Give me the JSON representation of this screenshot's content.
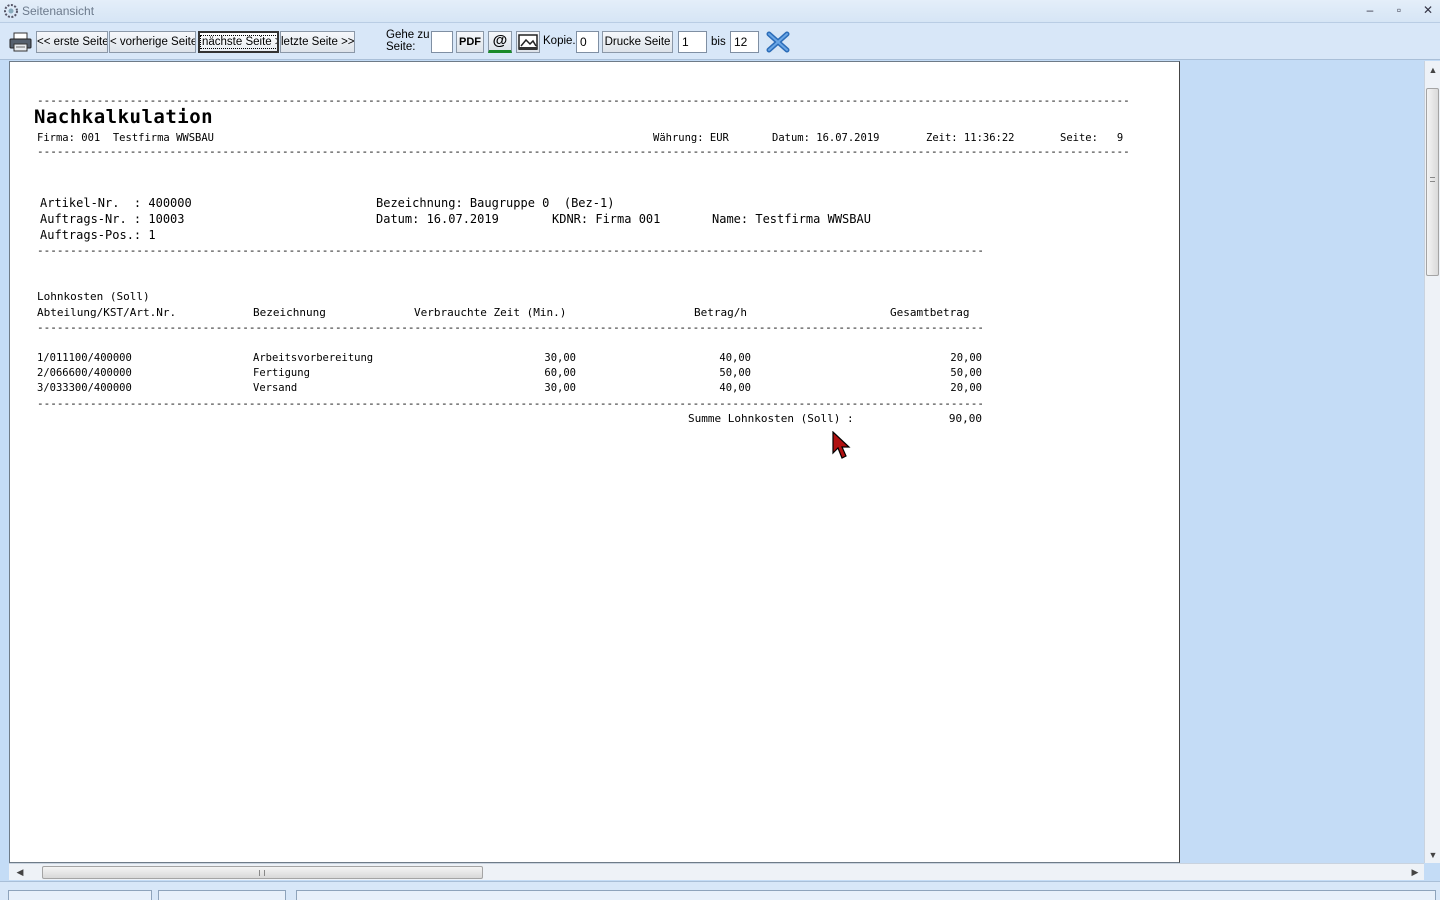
{
  "window": {
    "title": "Seitenansicht",
    "controls": {
      "minimize": "–",
      "restore": "▫",
      "close": "✕"
    }
  },
  "toolbar": {
    "first_page": "<< erste Seite",
    "prev_page": "< vorherige Seite",
    "next_page": "nächste Seite >",
    "last_page": "letzte Seite >>",
    "goto_label_1": "Gehe zu",
    "goto_label_2": "Seite:",
    "goto_value": "",
    "pdf_label": "PDF",
    "email_symbol": "@",
    "copies_label": "Kopie.:",
    "copies_value": "0",
    "print_pages_label": "Drucke Seite",
    "from_value": "1",
    "to_label": "bis",
    "to_value": "12",
    "icons": [
      "printer-icon",
      "email-icon",
      "image-export-icon",
      "close-preview-icon"
    ]
  },
  "report": {
    "title": "Nachkalkulation",
    "firma": "Firma: 001  Testfirma WWSBAU",
    "waehrung": "Währung: EUR",
    "datum": "Datum: 16.07.2019",
    "zeit": "Zeit: 11:36:22",
    "seite": "Seite:   9",
    "artikel_nr": "Artikel-Nr.  : 400000",
    "auftrags_nr": "Auftrags-Nr. : 10003",
    "auftrags_pos": "Auftrags-Pos.: 1",
    "bezeichnung": "Bezeichnung: Baugruppe 0  (Bez-1)",
    "datum2": "Datum: 16.07.2019",
    "kdnr": "KDNR: Firma 001",
    "name": "Name: Testfirma WWSBAU",
    "section_title": "Lohnkosten (Soll)",
    "columns": [
      "Abteilung/KST/Art.Nr.",
      "Bezeichnung",
      "Verbrauchte Zeit (Min.)",
      "Betrag/h",
      "Gesamtbetrag"
    ],
    "rows": [
      [
        "1/011100/400000",
        "Arbeitsvorbereitung",
        "30,00",
        "40,00",
        "20,00"
      ],
      [
        "2/066600/400000",
        "Fertigung",
        "60,00",
        "50,00",
        "50,00"
      ],
      [
        "3/033300/400000",
        "Versand",
        "30,00",
        "40,00",
        "20,00"
      ]
    ],
    "sum_label": "Summe Lohnkosten (Soll) :",
    "sum_value": "90,00"
  }
}
